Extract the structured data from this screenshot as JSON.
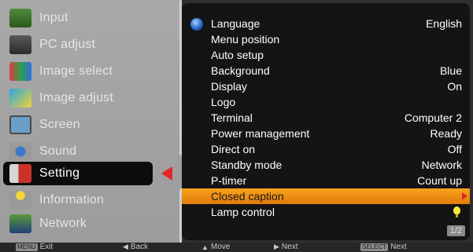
{
  "left_menu": {
    "items": [
      {
        "label": "Input",
        "icon": "input-icon"
      },
      {
        "label": "PC adjust",
        "icon": "pc-adjust-icon"
      },
      {
        "label": "Image select",
        "icon": "image-select-icon"
      },
      {
        "label": "Image adjust",
        "icon": "image-adjust-icon"
      },
      {
        "label": "Screen",
        "icon": "screen-icon"
      },
      {
        "label": "Sound",
        "icon": "sound-icon"
      },
      {
        "label": "Setting",
        "icon": "setting-icon",
        "selected": true
      },
      {
        "label": "Information",
        "icon": "information-icon"
      },
      {
        "label": "Network",
        "icon": "network-icon"
      }
    ]
  },
  "settings": {
    "rows": [
      {
        "label": "Language",
        "value": "English"
      },
      {
        "label": "Menu position",
        "value": ""
      },
      {
        "label": "Auto setup",
        "value": ""
      },
      {
        "label": "Background",
        "value": "Blue"
      },
      {
        "label": "Display",
        "value": "On"
      },
      {
        "label": "Logo",
        "value": ""
      },
      {
        "label": "Terminal",
        "value": "Computer 2"
      },
      {
        "label": "Power management",
        "value": "Ready"
      },
      {
        "label": "Direct on",
        "value": "Off"
      },
      {
        "label": "Standby mode",
        "value": "Network"
      },
      {
        "label": "P-timer",
        "value": "Count up"
      },
      {
        "label": "Closed caption",
        "value": "",
        "highlighted": true
      },
      {
        "label": "Lamp control",
        "value": ""
      }
    ],
    "page_indicator": "1/2"
  },
  "footer": {
    "exit_key": "MENU",
    "exit_label": "Exit",
    "back_label": "Back",
    "move_label": "Move",
    "next_label": "Next",
    "select_key": "SELECT",
    "select_next_label": "Next"
  },
  "colors": {
    "highlight": "#f39a1a",
    "accent_arrow": "#e3262b",
    "panel_bg": "#141414"
  }
}
